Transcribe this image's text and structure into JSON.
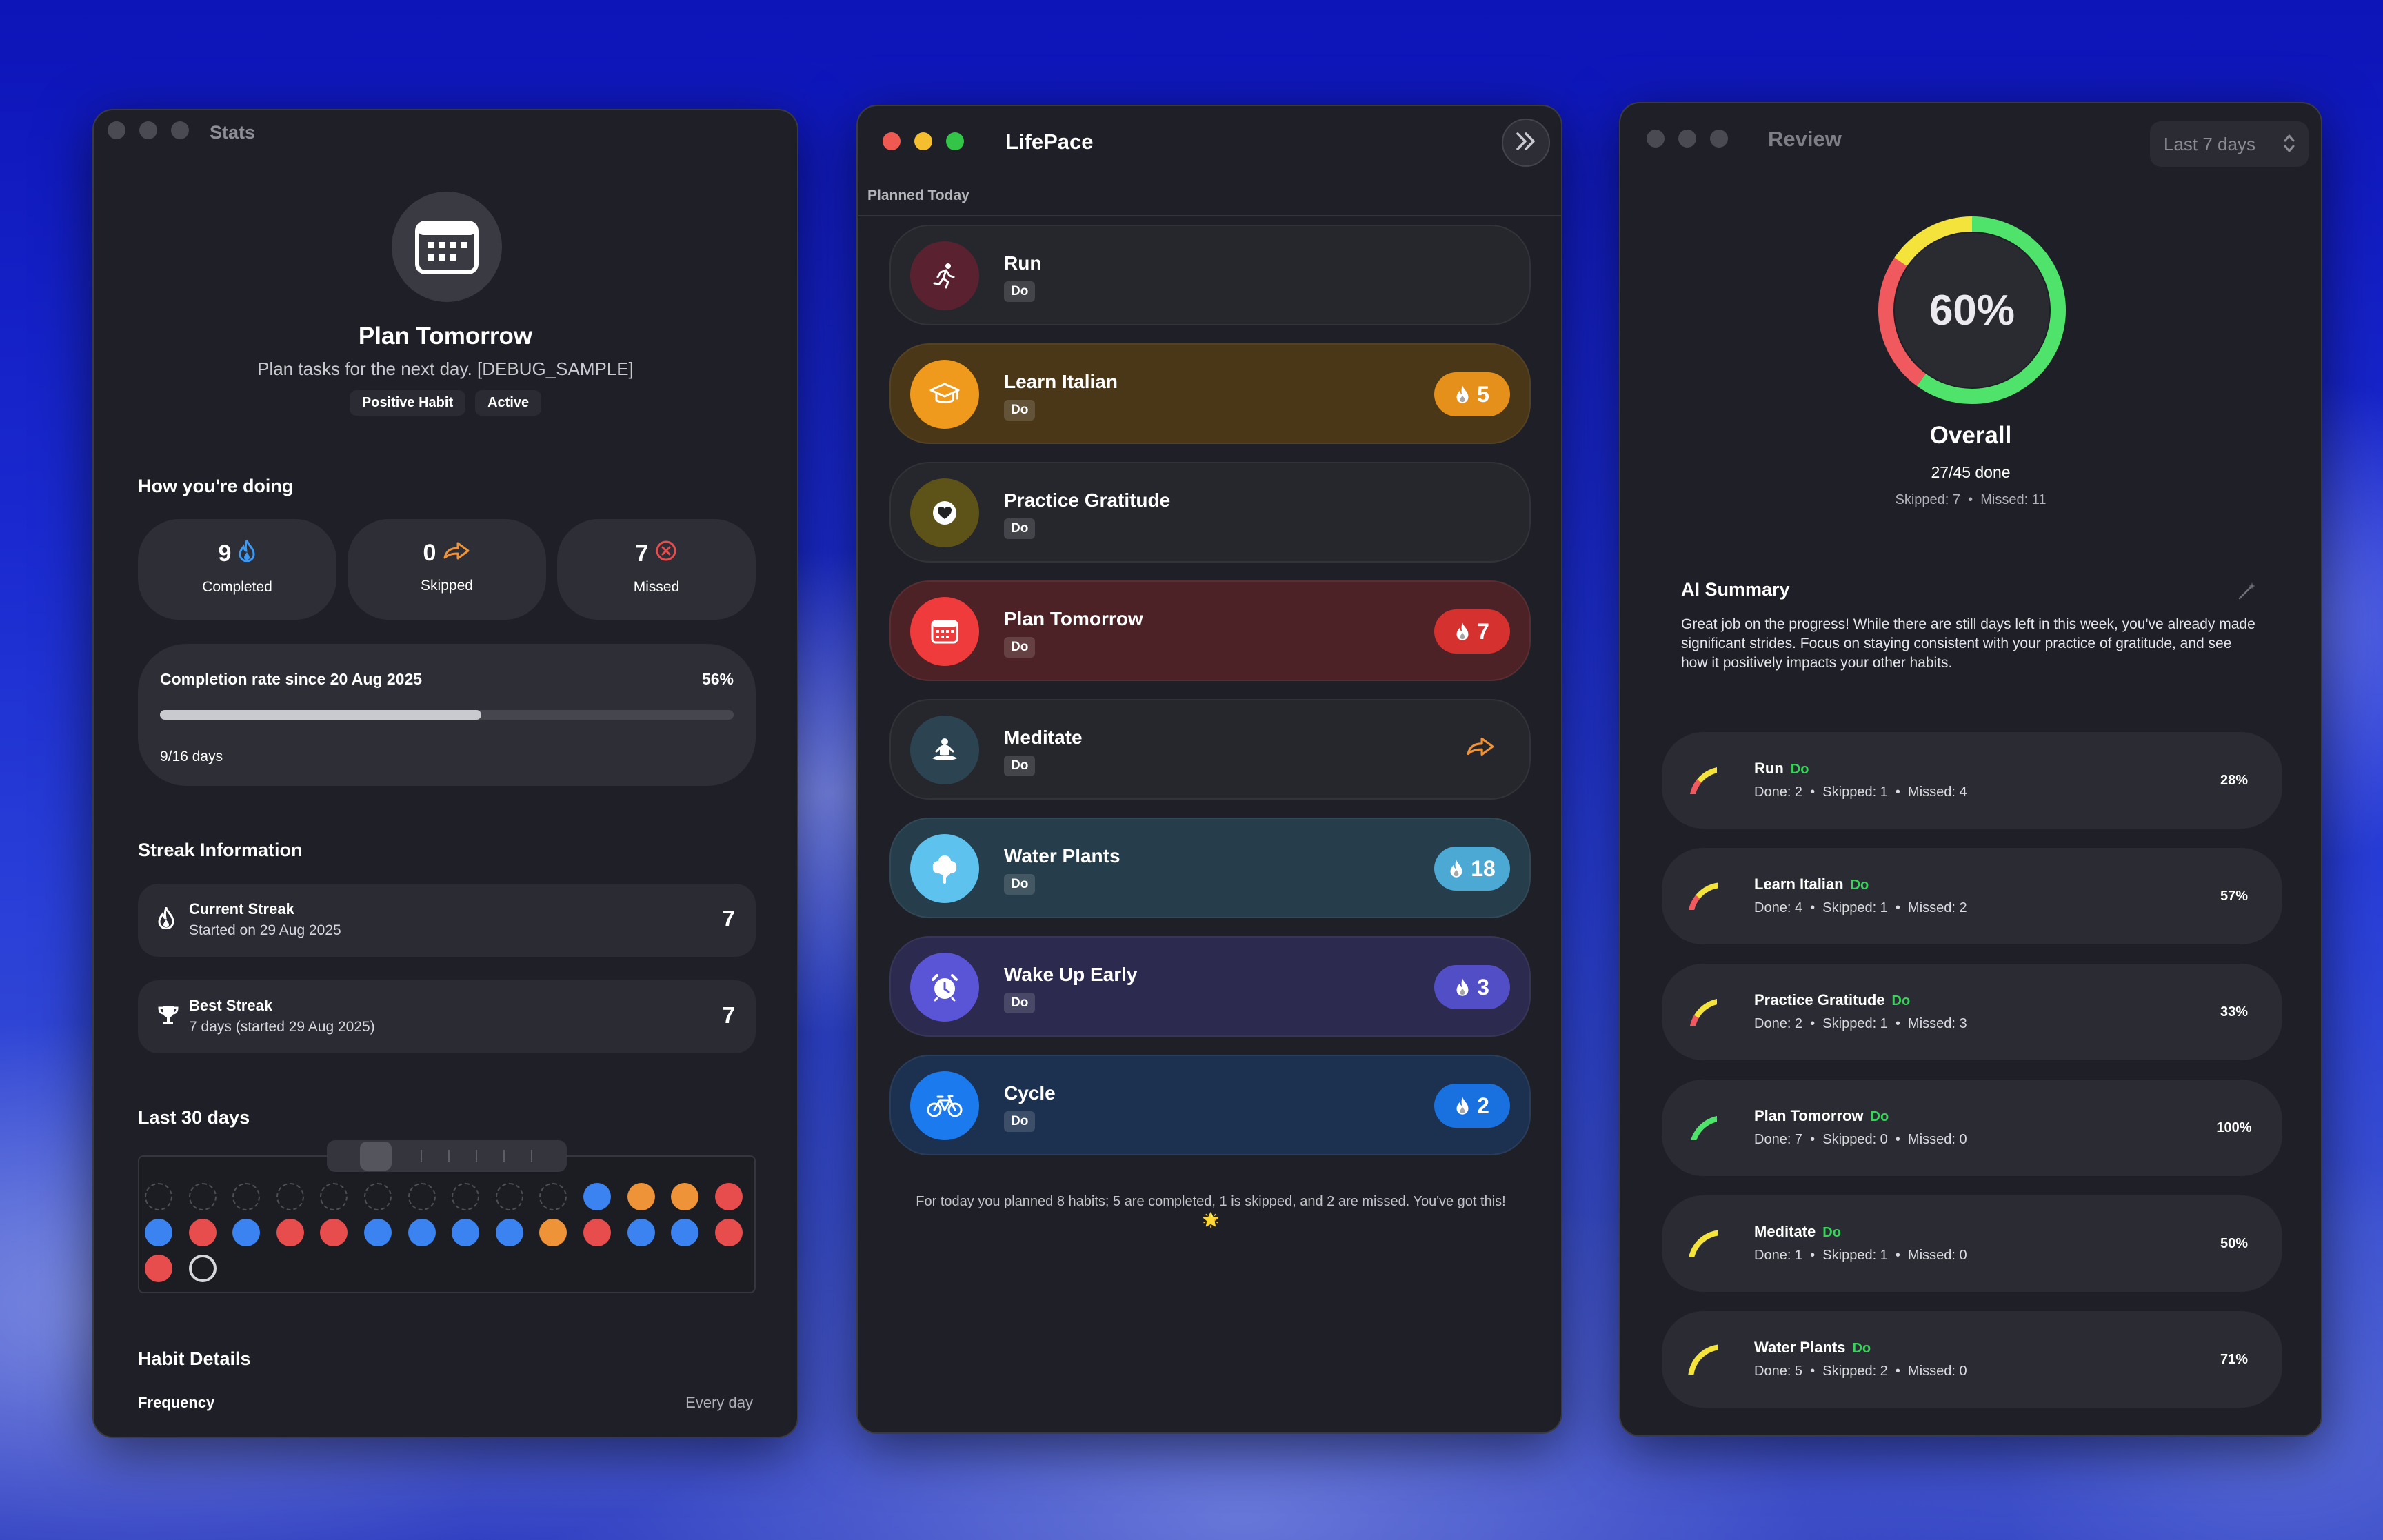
{
  "stats_window": {
    "title": "Stats",
    "habit_name": "Plan Tomorrow",
    "habit_description": "Plan tasks for the next day. [DEBUG_SAMPLE]",
    "tags": [
      "Positive Habit",
      "Active"
    ],
    "how_heading": "How you're doing",
    "completed": {
      "value": "9",
      "label": "Completed"
    },
    "skipped": {
      "value": "0",
      "label": "Skipped"
    },
    "missed": {
      "value": "7",
      "label": "Missed"
    },
    "completion_rate_label": "Completion rate since 20 Aug 2025",
    "completion_rate_pct": "56%",
    "completion_rate_fraction": 0.56,
    "completion_days": "9/16 days",
    "streak_heading": "Streak Information",
    "current_streak": {
      "title": "Current Streak",
      "sub": "Started on 29 Aug 2025",
      "value": "7"
    },
    "best_streak": {
      "title": "Best Streak",
      "sub": "7 days (started 29 Aug 2025)",
      "value": "7"
    },
    "last30_heading": "Last 30 days",
    "last30_days": [
      "empty",
      "empty",
      "empty",
      "empty",
      "empty",
      "empty",
      "empty",
      "empty",
      "empty",
      "empty",
      "blue",
      "orange",
      "orange",
      "red",
      "blue",
      "red",
      "blue",
      "red",
      "red",
      "blue",
      "blue",
      "blue",
      "blue",
      "orange",
      "red",
      "blue",
      "blue",
      "red",
      "red",
      "today"
    ],
    "details_heading": "Habit Details",
    "frequency_label": "Frequency",
    "frequency_value": "Every day",
    "colors": {
      "completed": "#3a83f1",
      "missed": "#e84d4d",
      "skipped": "#ef9338"
    }
  },
  "lifepace_window": {
    "title": "LifePace",
    "section_label": "Planned Today",
    "habits": [
      {
        "name": "Run",
        "action": "Do",
        "icon": "running-icon",
        "streak": "",
        "status": "pending",
        "bg": "#26272d",
        "circle": "#5a2230"
      },
      {
        "name": "Learn Italian",
        "action": "Do",
        "icon": "graduation-cap-icon",
        "streak": "5",
        "status": "completed",
        "bg": "#4a3718",
        "circle": "#ef9a1d",
        "badge": "#e5901a"
      },
      {
        "name": "Practice Gratitude",
        "action": "Do",
        "icon": "heart-icon",
        "streak": "",
        "status": "pending",
        "bg": "#26272d",
        "circle": "#5d5217"
      },
      {
        "name": "Plan Tomorrow",
        "action": "Do",
        "icon": "calendar-icon",
        "streak": "7",
        "status": "completed",
        "bg": "#4d2226",
        "circle": "#ef3b3b",
        "badge": "#d5312f"
      },
      {
        "name": "Meditate",
        "action": "Do",
        "icon": "meditation-icon",
        "streak": "",
        "status": "skipped",
        "bg": "#26272d",
        "circle": "#2c4452"
      },
      {
        "name": "Water Plants",
        "action": "Do",
        "icon": "tree-icon",
        "streak": "18",
        "status": "completed",
        "bg": "#263d4b",
        "circle": "#5ec2ee",
        "badge": "#4ba9d4"
      },
      {
        "name": "Wake Up Early",
        "action": "Do",
        "icon": "alarm-icon",
        "streak": "3",
        "status": "completed",
        "bg": "#2c2a4e",
        "circle": "#5a54d6",
        "badge": "#524fc6"
      },
      {
        "name": "Cycle",
        "action": "Do",
        "icon": "bicycle-icon",
        "streak": "2",
        "status": "completed",
        "bg": "#1c3150",
        "circle": "#1b7bee",
        "badge": "#1971e0"
      }
    ],
    "summary": "For today you planned 8 habits; 5 are completed, 1 is skipped, and 2 are missed. You've got this! 🌟"
  },
  "review_window": {
    "title": "Review",
    "range": "Last 7 days",
    "overall_pct": "60%",
    "overall_fraction": 0.6,
    "overall_label": "Overall",
    "done_text": "27/45 done",
    "skipped_text": "Skipped: 7",
    "missed_text": "Missed: 11",
    "ai_heading": "AI Summary",
    "ai_text": "Great job on the progress! While there are still days left in this week, you've already made significant strides. Focus on staying consistent with your practice of gratitude, and see how it positively impacts your other habits.",
    "items": [
      {
        "name": "Run",
        "action": "Do",
        "icon": "running-icon",
        "done": "Done: 2",
        "skipped": "Skipped: 1",
        "missed": "Missed: 4",
        "pct": "28%",
        "fraction": 0.28
      },
      {
        "name": "Learn Italian",
        "action": "Do",
        "icon": "graduation-cap-icon",
        "done": "Done: 4",
        "skipped": "Skipped: 1",
        "missed": "Missed: 2",
        "pct": "57%",
        "fraction": 0.57
      },
      {
        "name": "Practice Gratitude",
        "action": "Do",
        "icon": "heart-icon",
        "done": "Done: 2",
        "skipped": "Skipped: 1",
        "missed": "Missed: 3",
        "pct": "33%",
        "fraction": 0.33
      },
      {
        "name": "Plan Tomorrow",
        "action": "Do",
        "icon": "calendar-icon",
        "done": "Done: 7",
        "skipped": "Skipped: 0",
        "missed": "Missed: 0",
        "pct": "100%",
        "fraction": 1.0
      },
      {
        "name": "Meditate",
        "action": "Do",
        "icon": "meditation-icon",
        "done": "Done: 1",
        "skipped": "Skipped: 1",
        "missed": "Missed: 0",
        "pct": "50%",
        "fraction": 0.5
      },
      {
        "name": "Water Plants",
        "action": "Do",
        "icon": "tree-icon",
        "done": "Done: 5",
        "skipped": "Skipped: 2",
        "missed": "Missed: 0",
        "pct": "71%",
        "fraction": 0.71
      }
    ],
    "colors": {
      "done": "#4fe36c",
      "skipped": "#f4e33a",
      "missed": "#f05a5e"
    }
  }
}
